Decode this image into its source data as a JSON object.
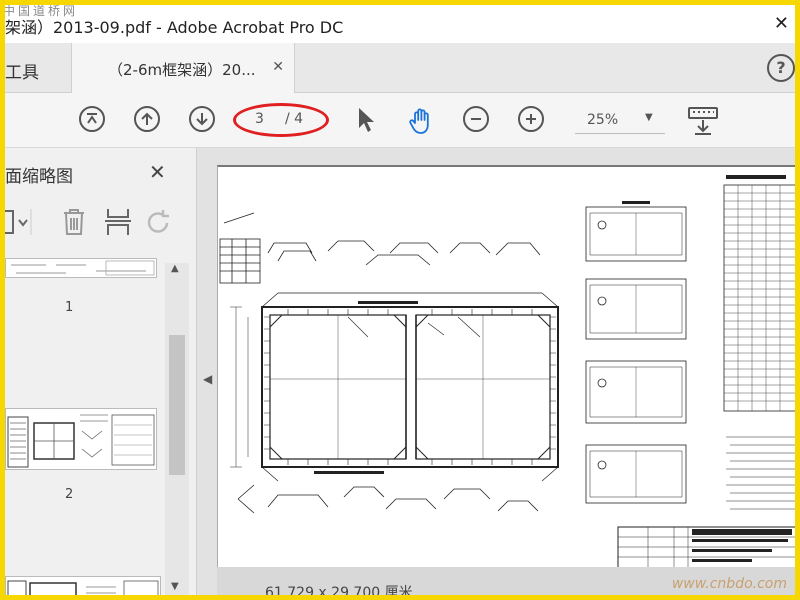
{
  "window": {
    "title": "架涵）2013-09.pdf - Adobe Acrobat Pro DC",
    "watermark": "中国道桥网"
  },
  "tabs": {
    "tools_label": "工具",
    "document_tab_label": "（2-6m框架涵）20...",
    "help_label": "?"
  },
  "toolbar": {
    "current_page": "3",
    "total_pages": "/ 4",
    "zoom": "25%",
    "accent_color": "#1a73d9",
    "annotation_color": "#e02020"
  },
  "sidepanel": {
    "title": "面缩略图",
    "thumbnails": [
      {
        "label": "1"
      },
      {
        "label": "2"
      }
    ]
  },
  "document": {
    "page_size": "61.729 x 29.700 厘米",
    "site_watermark": "www.cnbdo.com"
  }
}
